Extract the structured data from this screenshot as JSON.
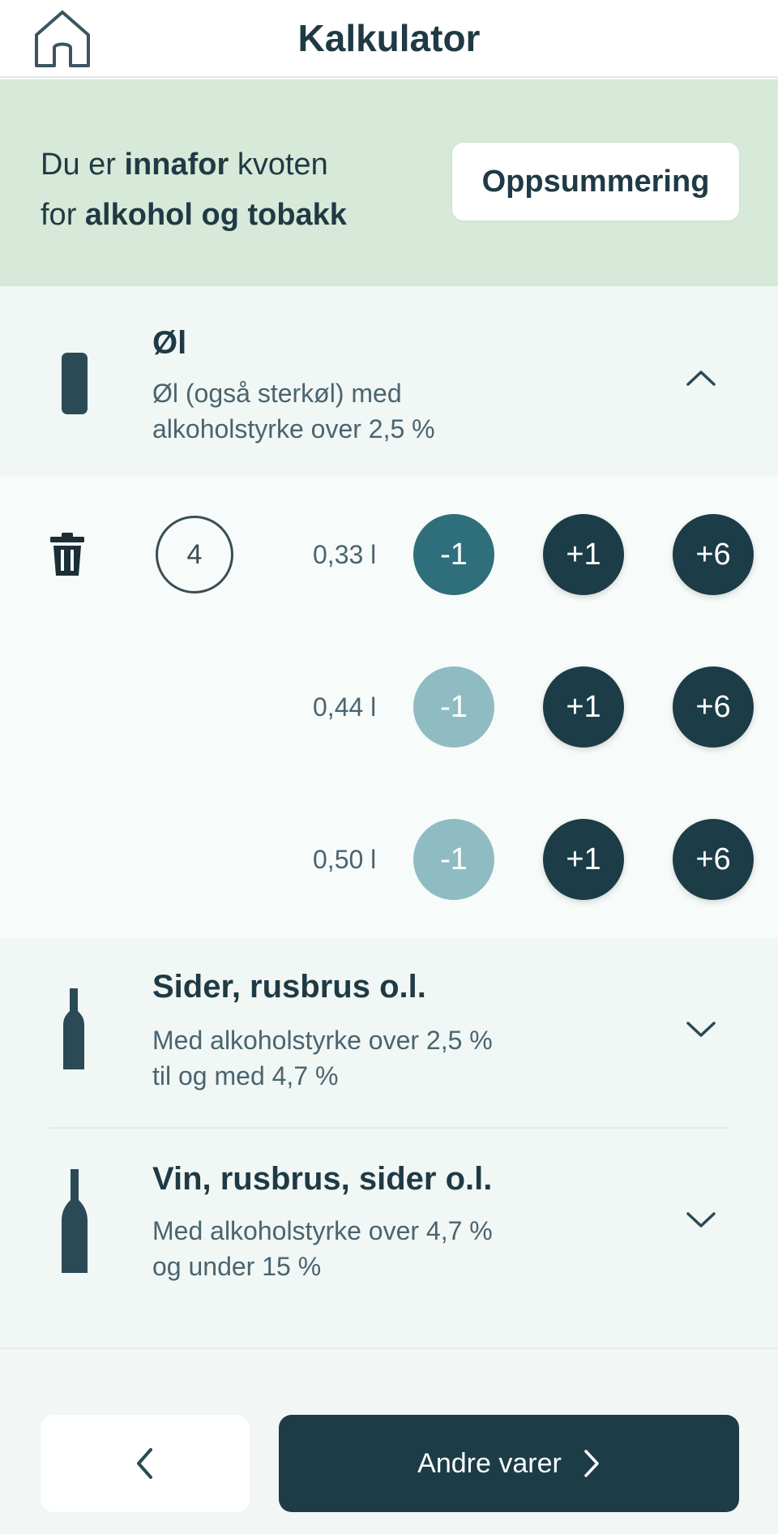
{
  "header": {
    "title": "Kalkulator",
    "home_icon": "home-icon"
  },
  "banner": {
    "line1_prefix": "Du er ",
    "line1_bold": "innafor",
    "line1_suffix": " kvoten",
    "line2_prefix": "for ",
    "line2_bold": "alkohol og tobakk",
    "summary_button": "Oppsummering",
    "background": "#d7e9d8"
  },
  "categories": [
    {
      "title": "Øl",
      "desc_line1": "Øl (også sterkøl) med",
      "desc_line2": "alkoholstyrke over 2,5 %",
      "icon": "can-icon",
      "expanded": true,
      "count": "4",
      "sizes": [
        {
          "label": "0,33 l",
          "minus": "-1",
          "plus1": "+1",
          "plus6": "+6",
          "minus_enabled": true
        },
        {
          "label": "0,44 l",
          "minus": "-1",
          "plus1": "+1",
          "plus6": "+6",
          "minus_enabled": false
        },
        {
          "label": "0,50 l",
          "minus": "-1",
          "plus1": "+1",
          "plus6": "+6",
          "minus_enabled": false
        }
      ]
    },
    {
      "title": "Sider, rusbrus o.l.",
      "desc_line1": "Med alkoholstyrke over 2,5 %",
      "desc_line2": "til og med 4,7 %",
      "icon": "small-bottle-icon",
      "expanded": false
    },
    {
      "title": "Vin, rusbrus, sider o.l.",
      "desc_line1": "Med alkoholstyrke over 4,7 %",
      "desc_line2": "og under 15 %",
      "icon": "wine-bottle-icon",
      "expanded": false
    }
  ],
  "footer": {
    "back_icon": "chevron-left-icon",
    "next_label": "Andre varer",
    "next_icon": "chevron-right-icon"
  },
  "colors": {
    "primary": "#1c3c47",
    "minus_active": "#2f6f7b",
    "minus_disabled": "#8fbcc3"
  }
}
